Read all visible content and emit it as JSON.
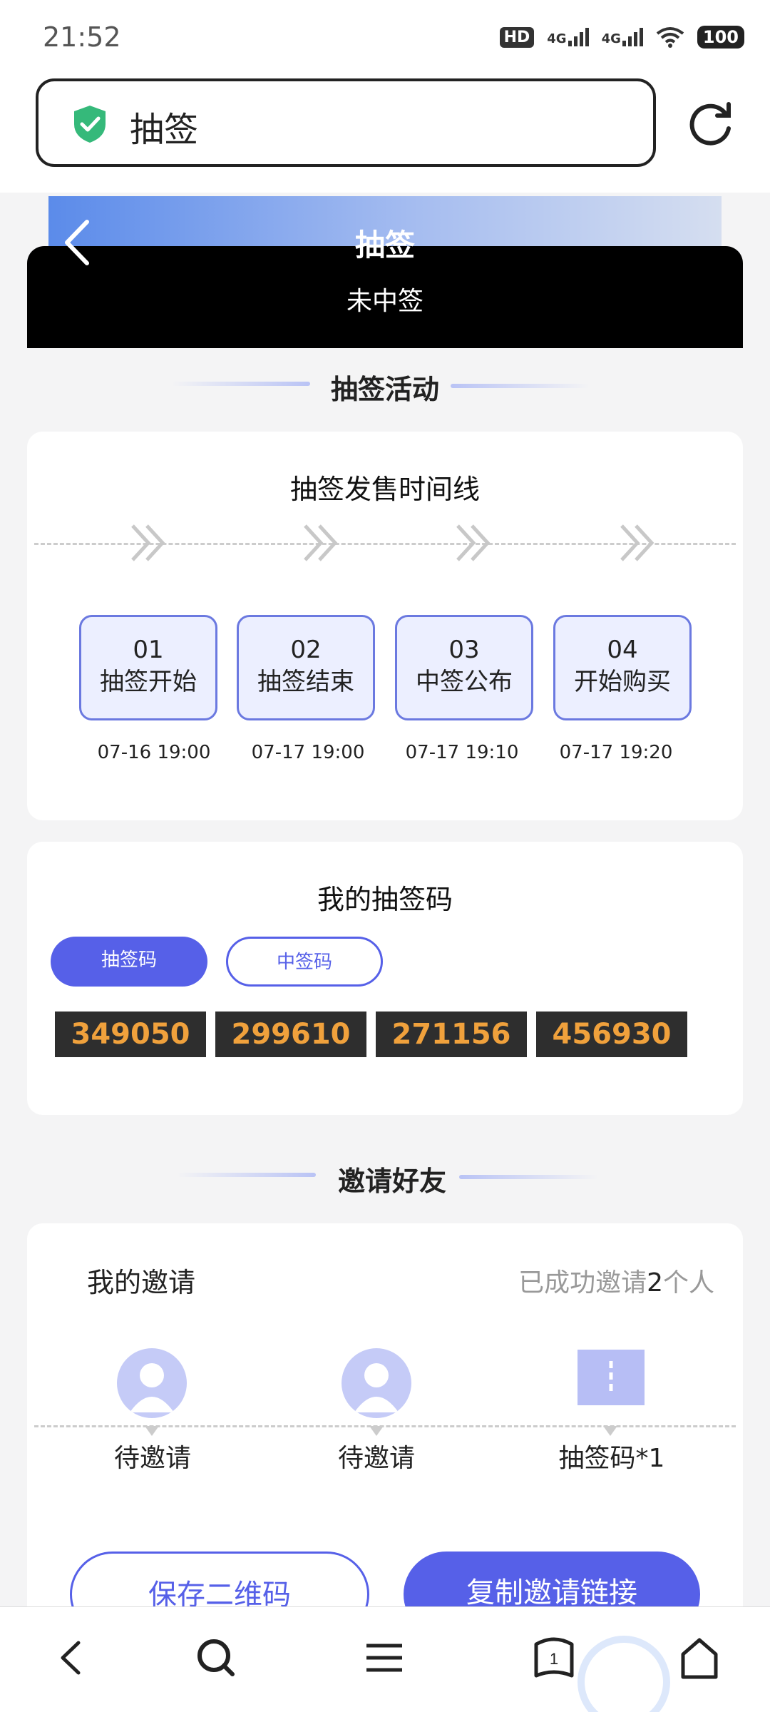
{
  "status_bar": {
    "time": "21:52",
    "battery": "100",
    "hd": "HD",
    "net1": "4G",
    "net2": "4G"
  },
  "address_bar": {
    "text": "抽签",
    "shield_icon": "shield-check-icon",
    "reload_icon": "reload-icon"
  },
  "header": {
    "title": "抽签",
    "result": "未中签"
  },
  "activity": {
    "section_title": "抽签活动",
    "card_title": "抽签发售时间线",
    "steps": [
      {
        "num": "01",
        "label": "抽签开始",
        "date": "07-16 19:00"
      },
      {
        "num": "02",
        "label": "抽签结束",
        "date": "07-17 19:00"
      },
      {
        "num": "03",
        "label": "中签公布",
        "date": "07-17 19:10"
      },
      {
        "num": "04",
        "label": "开始购买",
        "date": "07-17 19:20"
      }
    ]
  },
  "codes": {
    "title": "我的抽签码",
    "tabs": [
      "抽签码",
      "中签码"
    ],
    "values": [
      "349050",
      "299610",
      "271156",
      "456930"
    ]
  },
  "invite": {
    "section_title": "邀请好友",
    "my_invite": "我的邀请",
    "success_prefix": "已成功邀请",
    "success_count": "2",
    "success_suffix": "个人",
    "slots": [
      "待邀请",
      "待邀请",
      "抽签码*1"
    ],
    "save_button": "保存二维码",
    "copy_button": "复制邀请链接"
  },
  "colors": {
    "accent": "#5660e8",
    "code_text": "#f0a13c",
    "step_bg": "#ecefff"
  }
}
